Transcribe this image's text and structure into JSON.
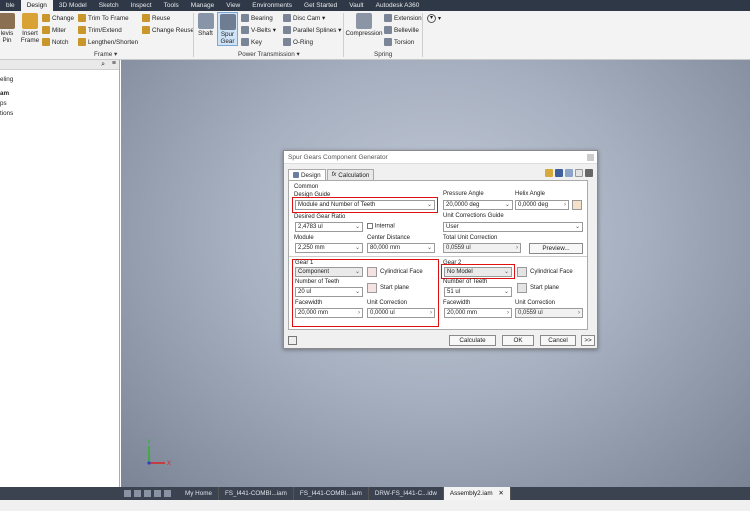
{
  "menu_tabs": [
    "ble",
    "Design",
    "3D Model",
    "Sketch",
    "Inspect",
    "Tools",
    "Manage",
    "View",
    "Environments",
    "Get Started",
    "Vault",
    "Autodesk A360"
  ],
  "ribbon": {
    "clevis_pin": "levis\nPin",
    "change": "Change",
    "miter": "Miter",
    "notch": "Notch",
    "insert_frame": "Insert\nFrame",
    "trim_to_frame": "Trim To Frame",
    "trim_extend": "Trim/Extend",
    "lengthen_shorten": "Lengthen/Shorten",
    "reuse": "Reuse",
    "change_reuse": "Change Reuse",
    "frame_group": "Frame ▾",
    "shaft": "Shaft",
    "spur_gear": "Spur\nGear",
    "bearing": "Bearing",
    "vbelts": "V-Belts ▾",
    "key": "Key",
    "disc_cam": "Disc Cam ▾",
    "parallel_splines": "Parallel Splines ▾",
    "oring": "O-Ring",
    "power_group": "Power Transmission ▾",
    "compression": "Compression",
    "extension": "Extension",
    "belleville": "Belleville",
    "torsion": "Torsion",
    "spring_group": "Spring"
  },
  "browser": {
    "items": [
      "eling",
      "am",
      "ps",
      "tions"
    ]
  },
  "dialog": {
    "title": "Spur Gears Component Generator",
    "tab_design": "Design",
    "tab_calculation": "Calculation",
    "common": "Common",
    "design_guide_label": "Design Guide",
    "design_guide_value": "Module and Number of Teeth",
    "pressure_angle_label": "Pressure Angle",
    "pressure_angle_value": "20,0000 deg",
    "helix_angle_label": "Helix Angle",
    "helix_angle_value": "0,0000 deg",
    "desired_ratio_label": "Desired Gear Ratio",
    "desired_ratio_value": "2,4783 ul",
    "internal_label": "Internal",
    "unit_corr_guide_label": "Unit Corrections Guide",
    "unit_corr_guide_value": "User",
    "module_label": "Module",
    "module_value": "2,250 mm",
    "center_distance_label": "Center Distance",
    "center_distance_value": "80,000 mm",
    "total_unit_corr_label": "Total Unit Correction",
    "total_unit_corr_value": "0,0559 ul",
    "preview_btn": "Preview...",
    "gear1_label": "Gear 1",
    "gear1_type": "Component",
    "cyl_face_1": "Cylindrical Face",
    "teeth1_label": "Number of Teeth",
    "teeth1_value": "20 ul",
    "start_plane_1": "Start plane",
    "facewidth1_label": "Facewidth",
    "facewidth1_value": "20,000 mm",
    "unitcorr1_label": "Unit Correction",
    "unitcorr1_value": "0,0000 ul",
    "gear2_label": "Gear 2",
    "gear2_type": "No Model",
    "cyl_face_2": "Cylindrical Face",
    "teeth2_label": "Number of Teeth",
    "teeth2_value": "51 ul",
    "start_plane_2": "Start plane",
    "facewidth2_label": "Facewidth",
    "facewidth2_value": "20,000 mm",
    "unitcorr2_label": "Unit Correction",
    "unitcorr2_value": "0,0559 ul",
    "calculate_btn": "Calculate",
    "ok_btn": "OK",
    "cancel_btn": "Cancel",
    "more_btn": ">>"
  },
  "doc_tabs": [
    "My Home",
    "FS_I441-COMBI...iam",
    "FS_I441-COMBI...iam",
    "DRW-FS_I441-C...idw",
    "Assembly2.iam"
  ],
  "triad": {
    "x": "X",
    "y": "Y"
  }
}
